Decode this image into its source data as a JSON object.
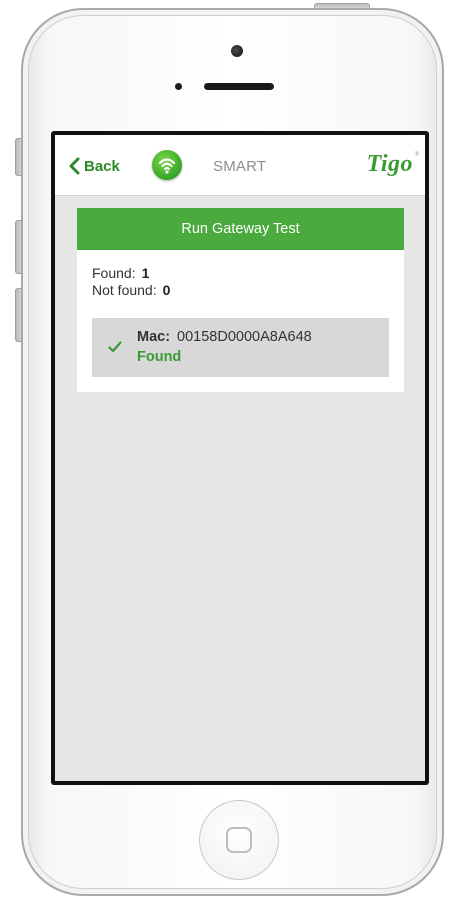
{
  "navbar": {
    "back_label": "Back",
    "title": "SMART",
    "brand": "Tigo",
    "brand_mark": "®"
  },
  "gateway_test": {
    "run_button_label": "Run Gateway Test",
    "found_label": "Found:",
    "found_count": "1",
    "not_found_label": "Not found:",
    "not_found_count": "0"
  },
  "devices": [
    {
      "mac_label": "Mac:",
      "mac_value": "00158D0000A8A648",
      "status": "Found",
      "status_icon": "check-icon"
    }
  ],
  "colors": {
    "accent_green": "#4aaa3e",
    "brand_green": "#3c9a35",
    "screen_background": "#e6e6e6"
  }
}
